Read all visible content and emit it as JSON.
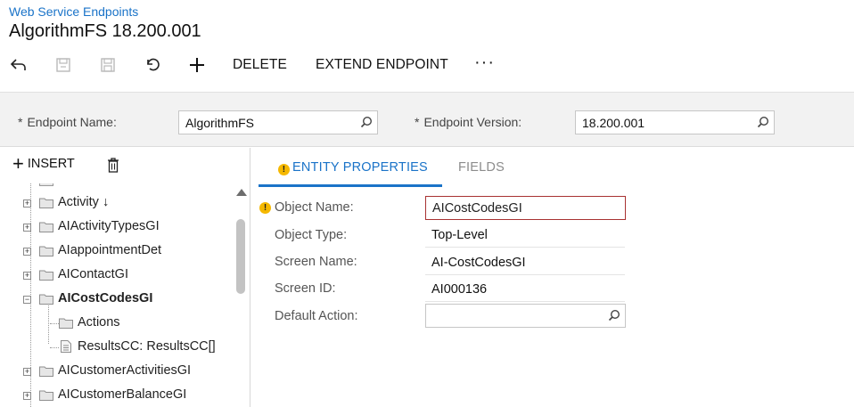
{
  "header": {
    "breadcrumb": "Web Service Endpoints",
    "title": "AlgorithmFS 18.200.001"
  },
  "toolbar": {
    "back_icon": "back-arrow-icon",
    "save_close_icon": "save-close-icon",
    "save_icon": "save-icon",
    "undo_icon": "undo-icon",
    "add_icon": "plus-icon",
    "delete_label": "DELETE",
    "extend_label": "EXTEND ENDPOINT",
    "more_label": "···"
  },
  "form": {
    "endpoint_name_label": "Endpoint Name:",
    "endpoint_name_value": "AlgorithmFS",
    "endpoint_version_label": "Endpoint Version:",
    "endpoint_version_value": "18.200.001",
    "required_mark": "*"
  },
  "tree_toolbar": {
    "insert_label": "INSERT",
    "delete_icon": "trash-icon"
  },
  "tree": {
    "items": [
      {
        "label": "Activity ↓"
      },
      {
        "label": "AIActivityTypesGI"
      },
      {
        "label": "AIappointmentDet"
      },
      {
        "label": "AIContactGI"
      },
      {
        "label": "AICostCodesGI"
      },
      {
        "label": "Actions"
      },
      {
        "label": "ResultsCC: ResultsCC[]"
      },
      {
        "label": "AICustomerActivitiesGI"
      },
      {
        "label": "AICustomerBalanceGI"
      }
    ]
  },
  "tabs": {
    "entity_properties": "ENTITY PROPERTIES",
    "fields": "FIELDS"
  },
  "entity": {
    "object_name_label": "Object Name:",
    "object_name_value": "AICostCodesGI",
    "object_type_label": "Object Type:",
    "object_type_value": "Top-Level",
    "screen_name_label": "Screen Name:",
    "screen_name_value": "AI-CostCodesGI",
    "screen_id_label": "Screen ID:",
    "screen_id_value": "AI000136",
    "default_action_label": "Default Action:",
    "default_action_value": ""
  },
  "colors": {
    "accent": "#1a73c8",
    "error_border": "#a83232",
    "warning": "#f5b800"
  }
}
